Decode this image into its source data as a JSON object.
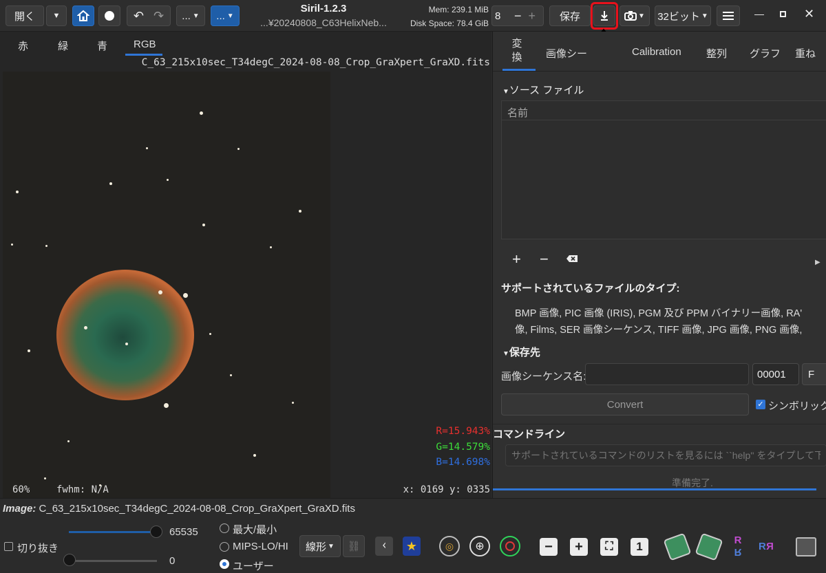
{
  "toolbar": {
    "open_label": "開く",
    "dotdot1": "...",
    "dotdot2": "...",
    "app_title": "Siril-1.2.3",
    "app_subtitle": "...¥20240808_C63HelixNeb...",
    "mem": "Mem: 239.1 MiB",
    "disk": "Disk Space: 78.4 GiB",
    "threads": "8",
    "save_label": "保存",
    "bitdepth": "32ビット"
  },
  "channel_tabs": [
    "赤",
    "緑",
    "青",
    "RGB"
  ],
  "image": {
    "filename": "C_63_215x10sec_T34degC_2024-08-08_Crop_GraXpert_GraXD.fits",
    "r": "R=15.943%",
    "g": "G=14.579%",
    "b": "B=14.698%",
    "zoom": "60%",
    "fwhm": "fwhm: N/A",
    "coords": "x: 0169 y: 0335"
  },
  "right_tabs": [
    "変\n換",
    "画像シー",
    "Calibration",
    "整列",
    "グラフ",
    "重ね"
  ],
  "convert": {
    "source_header": "ソース ファイル",
    "col_name": "名前",
    "supported_title": "サポートされているファイルのタイプ:",
    "supported_line1": "BMP 画像, PIC 画像 (IRIS), PGM 及び PPM バイナリー画像, RA'",
    "supported_line2": "像, Films, SER 画像シーケンス, TIFF 画像, JPG 画像, PNG 画像,",
    "dest_header": "保存先",
    "seq_label": "画像シーケンス名:",
    "seq_value": "",
    "start_index": "00001",
    "extra": "F",
    "convert_btn": "Convert",
    "symlink_label": "シンボリック"
  },
  "cmdline": {
    "header": "コマンドライン",
    "placeholder": "サポートされているコマンドのリストを見るには ``help'' をタイプして下さ",
    "status": "準備完了."
  },
  "bottom": {
    "image_label": "Image:",
    "image_name": "C_63_215x10sec_T34degC_2024-08-08_Crop_GraXpert_GraXD.fits",
    "crop_label": "切り抜き",
    "hi_value": "65535",
    "lo_value": "0",
    "hi_fraction": 1.0,
    "lo_fraction": 0.0,
    "radio_minmax": "最大/最小",
    "radio_mips": "MIPS-LO/HI",
    "radio_user": "ユーザー",
    "scale_mode": "線形"
  },
  "colors": {
    "accent": "#1f5ea8",
    "red_label": "#e8302e",
    "green_label": "#3ddc3a",
    "blue_label": "#2f6fe0",
    "arrow": "#e8121c"
  }
}
